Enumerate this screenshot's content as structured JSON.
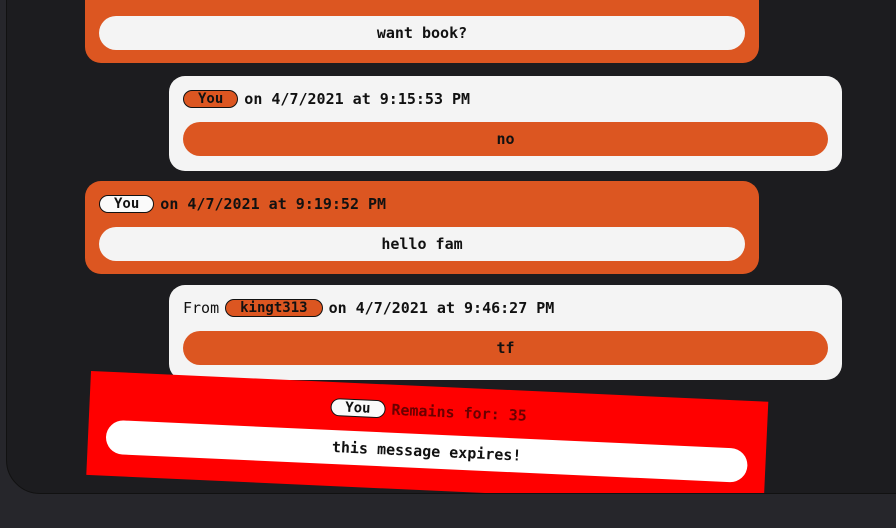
{
  "messages": [
    {
      "body": "want book?"
    },
    {
      "sender": "You",
      "timestamp": "on 4/7/2021 at 9:15:53 PM",
      "body": "no"
    },
    {
      "sender": "You",
      "timestamp": "on 4/7/2021 at 9:19:52 PM",
      "body": "hello fam"
    },
    {
      "from_label": "From",
      "sender": "kingt313",
      "timestamp": "on 4/7/2021 at 9:46:27 PM",
      "body": "tf"
    },
    {
      "sender": "You",
      "remains_label": "Remains for: 35",
      "body": "this message expires!"
    }
  ],
  "colors": {
    "orange": "#dc5621",
    "light": "#f4f4f4",
    "ephemeral": "#ff0000",
    "background": "#1c1c1f"
  }
}
